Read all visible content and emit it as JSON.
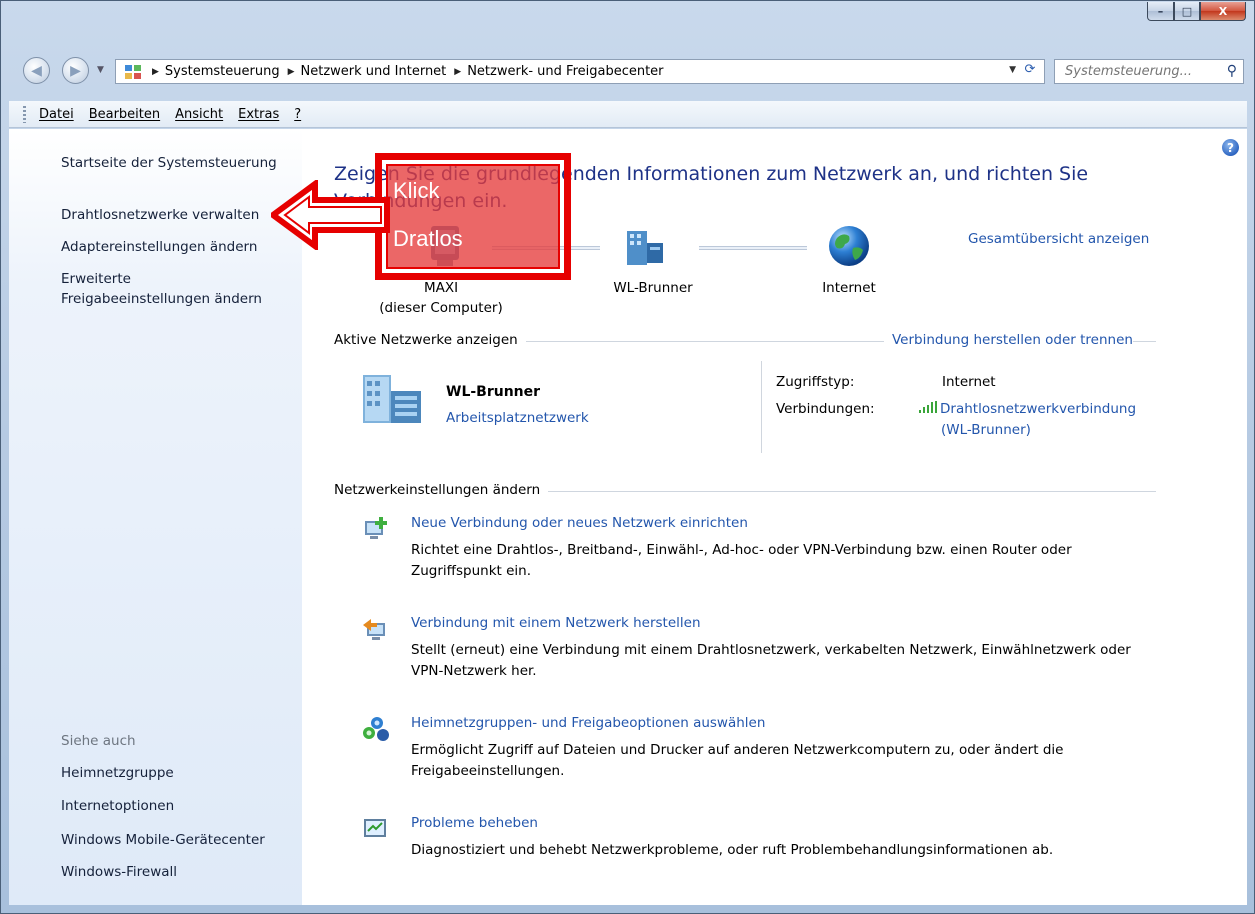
{
  "window": {
    "minimize": "–",
    "maximize": "□",
    "close": "X"
  },
  "nav": {
    "back": "◀",
    "forward": "▶",
    "breadcrumb": [
      "Systemsteuerung",
      "Netzwerk und Internet",
      "Netzwerk- und Freigabecenter"
    ],
    "search_placeholder": "Systemsteuerung..."
  },
  "menu": [
    "Datei",
    "Bearbeiten",
    "Ansicht",
    "Extras",
    "?"
  ],
  "sidebar": {
    "items": [
      "Startseite der Systemsteuerung",
      "Drahtlosnetzwerke verwalten",
      "Adaptereinstellungen ändern",
      "Erweiterte",
      "Freigabeeinstellungen ändern"
    ],
    "see_also_title": "Siehe auch",
    "see_also": [
      "Heimnetzgruppe",
      "Internetoptionen",
      "Windows Mobile-Gerätecenter",
      "Windows-Firewall"
    ]
  },
  "main": {
    "title_line1": "Zeigen Sie die grundlegenden Informationen zum Netzwerk an, und richten Sie",
    "title_line2": "Verbindungen ein.",
    "overview_link": "Gesamtübersicht anzeigen",
    "map": {
      "computer_name": "MAXI",
      "computer_sub": "(dieser Computer)",
      "network": "WL-Brunner",
      "internet": "Internet"
    },
    "active_section": "Aktive Netzwerke anzeigen",
    "connect_link": "Verbindung herstellen oder trennen",
    "active_network": {
      "name": "WL-Brunner",
      "category": "Arbeitsplatznetzwerk",
      "access_label": "Zugriffstyp:",
      "access_value": "Internet",
      "connections_label": "Verbindungen:",
      "connection_line1": "Drahtlosnetzwerkverbindung",
      "connection_line2": "(WL-Brunner)"
    },
    "settings_section": "Netzwerkeinstellungen ändern",
    "tasks": [
      {
        "link": "Neue Verbindung oder neues Netzwerk einrichten",
        "desc": "Richtet eine Drahtlos-, Breitband-, Einwähl-, Ad-hoc- oder VPN-Verbindung bzw. einen Router oder Zugriffspunkt ein."
      },
      {
        "link": "Verbindung mit einem Netzwerk herstellen",
        "desc": "Stellt (erneut) eine Verbindung mit einem Drahtlosnetzwerk, verkabelten Netzwerk, Einwählnetzwerk oder VPN-Netzwerk her."
      },
      {
        "link": "Heimnetzgruppen- und Freigabeoptionen auswählen",
        "desc": "Ermöglicht Zugriff auf Dateien und Drucker auf anderen Netzwerkcomputern zu, oder ändert die Freigabeeinstellungen."
      },
      {
        "link": "Probleme beheben",
        "desc": "Diagnostiziert und behebt Netzwerkprobleme, oder ruft Problembehandlungsinformationen ab."
      }
    ]
  },
  "annotation": {
    "line1": "Klick",
    "line2": "Dratlos",
    "color": "#e60000"
  },
  "help": "?"
}
